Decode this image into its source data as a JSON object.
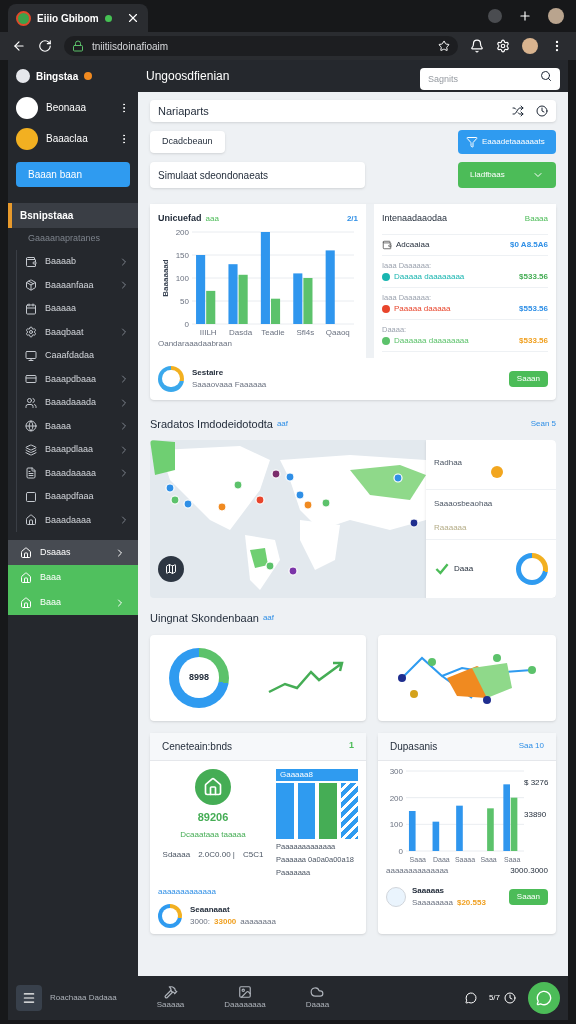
{
  "browser": {
    "tab_title": "Eiiio Gbibom",
    "address": "tniitiisdoinafioaim"
  },
  "sidebar": {
    "brand": "Bingstaa",
    "profiles": [
      {
        "name": "Beonaaa"
      },
      {
        "name": "Baaaclaa"
      }
    ],
    "primary_button": "Baaan baan",
    "active": {
      "label": "Bsnipstaaa",
      "selected": true
    },
    "group_label": "Gaaaanapratanes",
    "nav": [
      {
        "label": "Baaaab",
        "chevron": true
      },
      {
        "label": "Baaaanfaaa",
        "chevron": true
      },
      {
        "label": "Baaaaa",
        "chevron": false
      },
      {
        "label": "Baaqbaat",
        "chevron": true
      },
      {
        "label": "Caaafdadaa",
        "chevron": false
      },
      {
        "label": "Baaapdbaaa",
        "chevron": true
      },
      {
        "label": "Baaadaaada",
        "chevron": true
      },
      {
        "label": "Baaaa",
        "chevron": true
      },
      {
        "label": "Baaapdlaaa",
        "chevron": true
      },
      {
        "label": "Baaadaaaaa",
        "chevron": true
      },
      {
        "label": "Baaapdfaaa",
        "chevron": false
      },
      {
        "label": "Baaadaaaa",
        "chevron": true
      }
    ],
    "footer": [
      {
        "label": "Dsaaas",
        "kind": "muted",
        "chevron": true
      },
      {
        "label": "Baaa",
        "kind": "accent",
        "chevron": false
      },
      {
        "label": "Baaa",
        "kind": "accent",
        "chevron": true
      }
    ]
  },
  "header": {
    "title": "Ungoosdfienian",
    "search": {
      "placeholder": "Sagnits"
    }
  },
  "panel": {
    "title": "Nariaparts"
  },
  "toolbar": {
    "filter_button": "Dcadcbeaun",
    "primary_button": "Eaaadetaaaaaats",
    "field": {
      "value": "Simulaat sdeondonaeats"
    },
    "dropdown": "Lladfbaas"
  },
  "overview": {
    "chart_card": {
      "title": "Unicuefad",
      "tag": "aaa",
      "corner": "2/1",
      "legend": "Oandaraaadaabraan",
      "chart_data": {
        "type": "bar",
        "ylabel": "Baaaaaad",
        "categories": [
          "IIILH",
          "Dasda",
          "Teadie",
          "Sfl4s",
          "Qaaoq"
        ],
        "series": [
          {
            "color": "#2f96ee",
            "values": [
              150,
              130,
              200,
              110,
              160
            ]
          },
          {
            "color": "#5cc26b",
            "values": [
              72,
              107,
              55,
              100,
              null
            ]
          }
        ],
        "ylim": [
          0,
          200
        ],
        "yticks": [
          0,
          50,
          100,
          150,
          200
        ],
        "grid": true
      }
    },
    "transactions": {
      "title": "Intenaadaaodaa",
      "link": "Baaaa",
      "rows": [
        {
          "name": "Adcaaiaa",
          "amount": {
            "text": "$0 A8.5A6",
            "color": "#2f8fe6"
          },
          "kind": "icon"
        },
        {
          "caption": "Iaaa Daaaaaa:",
          "name": "Daaaaa daaaaaaaa",
          "amount": {
            "text": "$533.56",
            "color": "#45ad55"
          },
          "kind": "dot",
          "color": "#19b5b0"
        },
        {
          "caption": "Iaaa Daaaaaa:",
          "name": "Paaaaa daaaaa",
          "amount": {
            "text": "$553.56",
            "color": "#2f8fe6"
          },
          "kind": "dot",
          "color": "#e8452c"
        },
        {
          "caption": "Daaaa:",
          "name": "Daaaaaa daaaaaaaa",
          "amount": {
            "text": "$533.56",
            "color": "#f0a020"
          },
          "kind": "dot",
          "color": "#5cc26b"
        }
      ]
    },
    "summary": {
      "title": "Sestaire",
      "subtitle": "Saaaovaaa Faaaaaa",
      "button": "Saaan"
    }
  },
  "map_section": {
    "title": "Sradatos Imdodeidotodta",
    "tag": "aaf",
    "link": "Sean 5",
    "overlay": {
      "title": "Radhaa",
      "subtitle": "Saaaosbeaohaa",
      "note": "Raaaaaa",
      "caption": "Daaa"
    }
  },
  "insights": {
    "title": "Uingnat Skondenbaan",
    "tag": "aaf",
    "donut_label": "8998"
  },
  "properties": {
    "title": "Ceneteain:bnds",
    "badge": "1",
    "amount": "89206",
    "amount_caption": "Dcaaataaa taaaaa",
    "stats": [
      "Sdaaaa",
      "2.0C0.00 |",
      "C5C1"
    ],
    "building_label": "Gaaaaa8",
    "details": [
      "Paaaaaaaaaaaaa",
      "Paaaaaa 0a0a0a00a18",
      "Paaaaaaa"
    ],
    "legend": "aaaaaaaaaaaaa",
    "footer": {
      "title": "Seaanaaat",
      "values": [
        "3000:",
        "33000",
        "aaaaaaaa"
      ]
    }
  },
  "deposits": {
    "title": "Dupasanis",
    "link": "Saa 10",
    "callouts": [
      "$ 3276",
      "33890"
    ],
    "legend": "aaaaaaaaaaaaaa",
    "total": "3000.3000",
    "chart_data": {
      "type": "bar",
      "categories": [
        "Saaa",
        "Daaa",
        "Saaaa",
        "Saaa",
        "Saaa"
      ],
      "series": [
        {
          "color": "#2f96ee",
          "values": [
            150,
            110,
            170,
            null,
            250
          ]
        },
        {
          "color": "#5cc26b",
          "values": [
            null,
            null,
            null,
            160,
            200
          ]
        }
      ],
      "ylim": [
        0,
        300
      ],
      "yticks": [
        0,
        100,
        200,
        300
      ],
      "grid": true
    },
    "footer": {
      "title": "Saaaaas",
      "subtitle": "Saaaaaaaa",
      "amount": "$20.553",
      "button": "Saaan"
    }
  },
  "bottom_bar": {
    "title": "Roachaaa Dadaaa",
    "items": [
      "Saaaaa",
      "Daaaaaaaa",
      "Daaaa"
    ],
    "counter": "5/7"
  }
}
